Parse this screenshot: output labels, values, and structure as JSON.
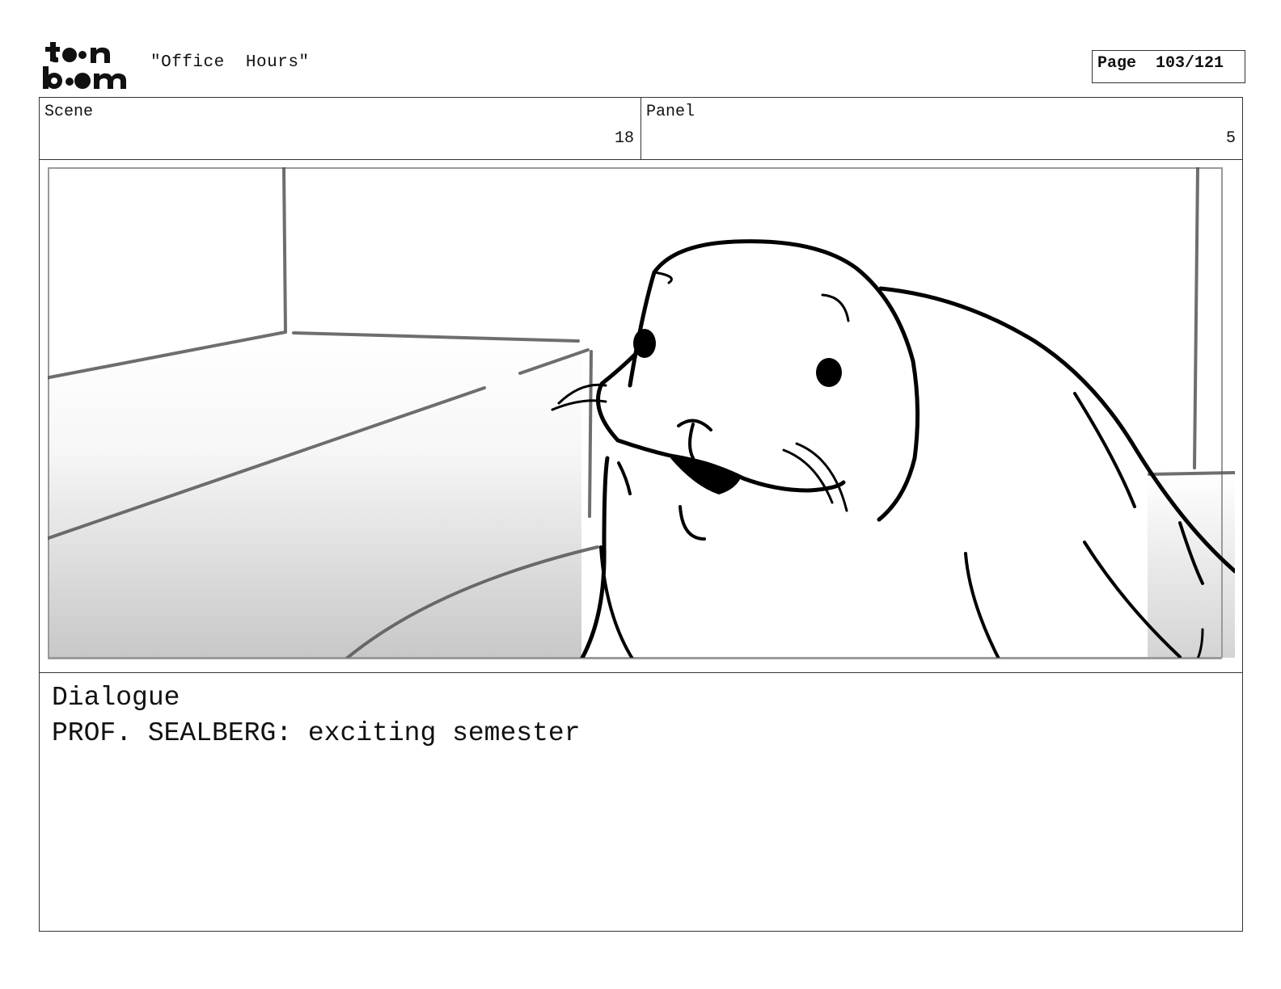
{
  "header": {
    "logo_text_top": "toon",
    "logo_text_bottom": "boom",
    "title": "\"Office  Hours\"",
    "page_label": "Page  103/121"
  },
  "info": {
    "scene_label": "Scene",
    "scene_value": "18",
    "panel_label": "Panel",
    "panel_value": "5"
  },
  "panel_art": {
    "subject": "seal-character",
    "icon": "seal-sketch-icon"
  },
  "dialogue": {
    "label": "Dialogue",
    "text": "PROF. SEALBERG: exciting semester"
  }
}
